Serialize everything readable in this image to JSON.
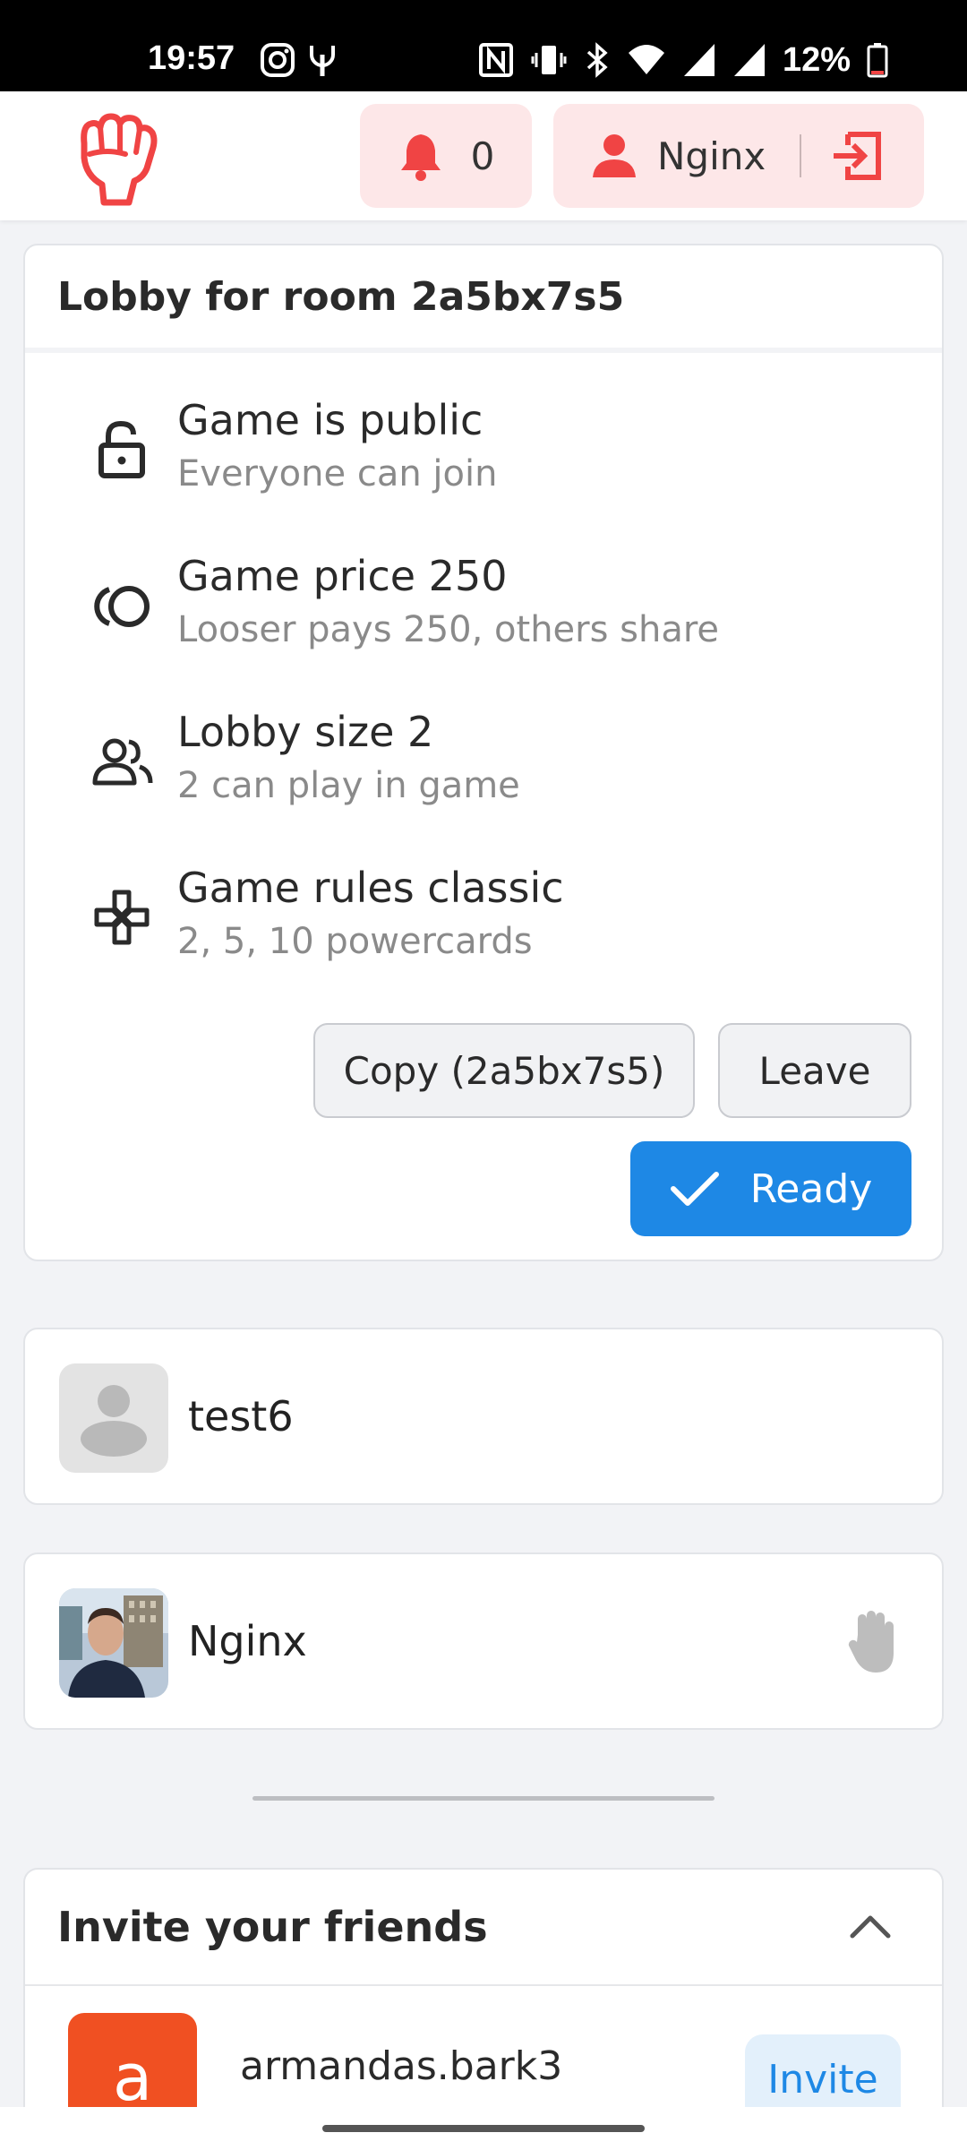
{
  "status_bar": {
    "time": "19:57",
    "battery": "12%",
    "icons": [
      "instagram-icon",
      "antenna-icon",
      "nfc-icon",
      "vibrate-icon",
      "bluetooth-icon",
      "wifi-icon",
      "signal-icon",
      "battery-icon"
    ]
  },
  "header": {
    "logo_icon": "raised-fist-icon",
    "notifications_count": "0",
    "user_name": "Nginx",
    "accent_color": "#f04444"
  },
  "lobby": {
    "title": "Lobby for room 2a5bx7s5",
    "items": [
      {
        "icon": "lock-icon",
        "title": "Game is public",
        "subtitle": "Everyone can join"
      },
      {
        "icon": "coins-icon",
        "title": "Game price 250",
        "subtitle": "Looser pays 250, others share"
      },
      {
        "icon": "users-icon",
        "title": "Lobby size 2",
        "subtitle": "2 can play in game"
      },
      {
        "icon": "gamepad-icon",
        "title": "Game rules classic",
        "subtitle": "2, 5, 10 powercards"
      }
    ],
    "copy_label": "Copy (2a5bx7s5)",
    "leave_label": "Leave",
    "ready_label": "Ready",
    "ready_color": "#1e88e5"
  },
  "players": [
    {
      "name": "test6",
      "avatar": "default-avatar-icon"
    },
    {
      "name": "Nginx",
      "avatar": "user-photo",
      "status_icon": "hand-icon"
    }
  ],
  "invite": {
    "title": "Invite your friends",
    "friends": [
      {
        "initial": "a",
        "name": "armandas.bark3",
        "action": "Invite"
      }
    ]
  }
}
